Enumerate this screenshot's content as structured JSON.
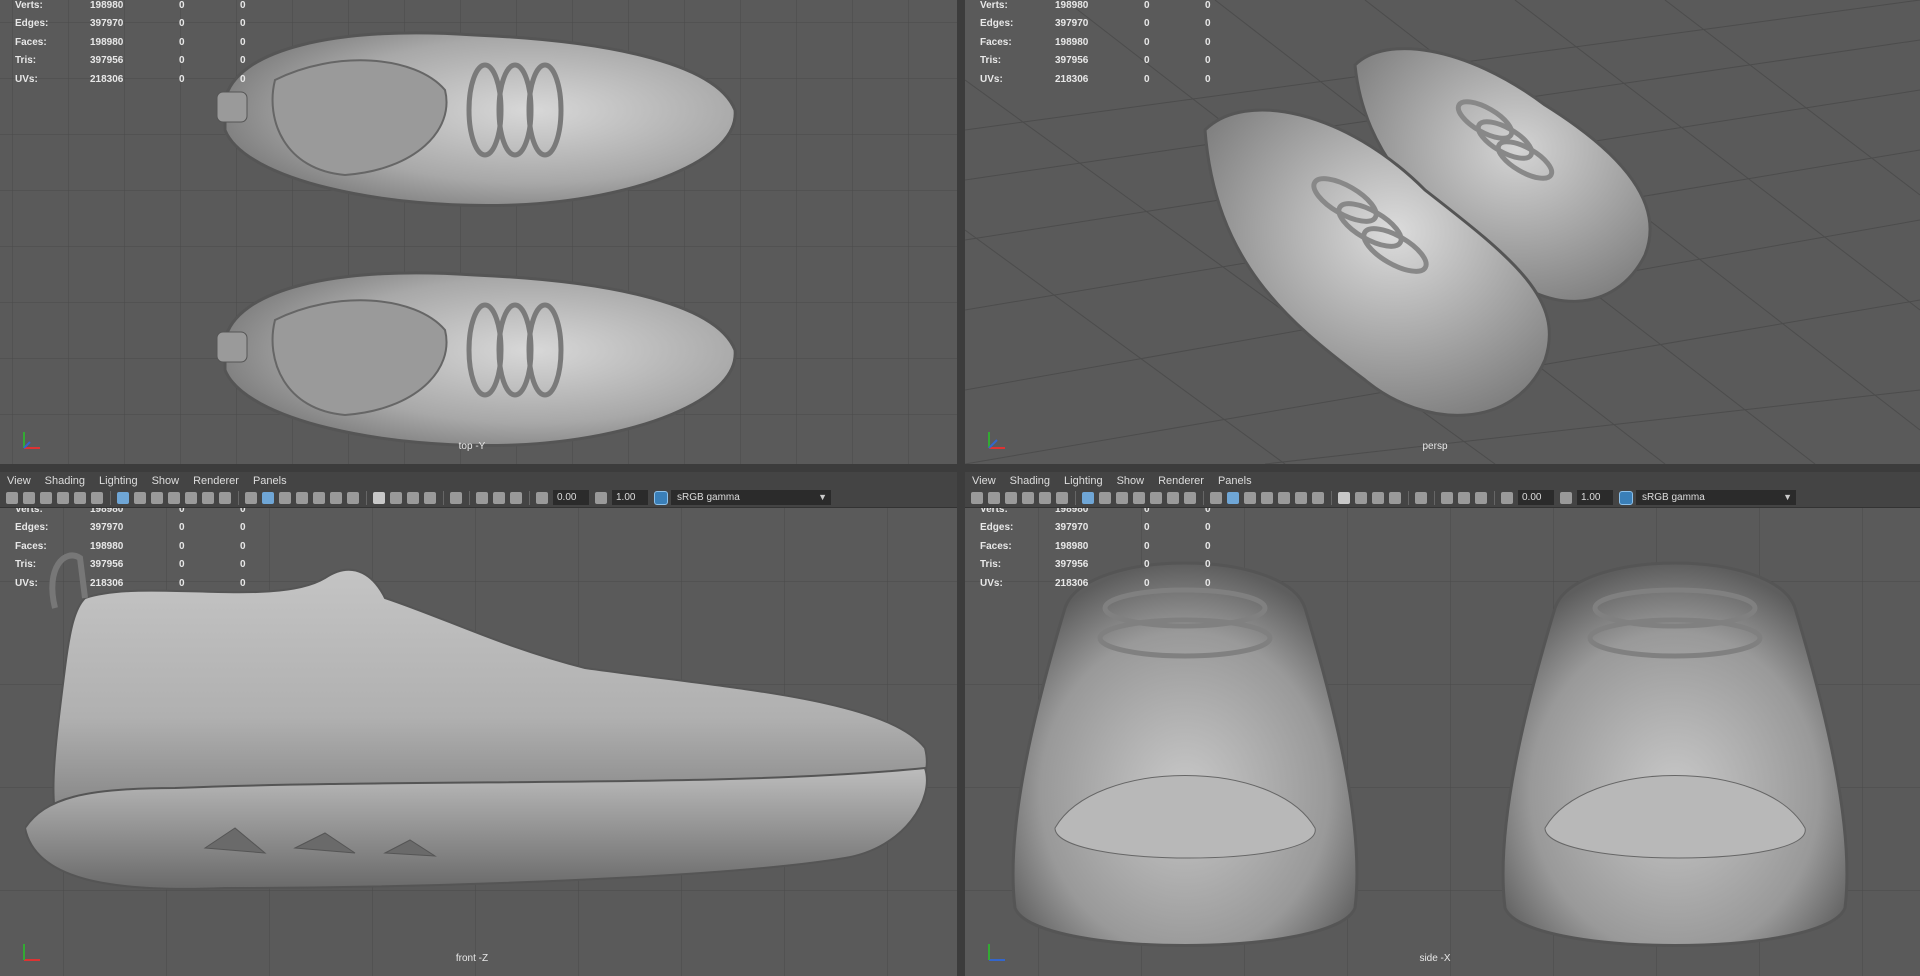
{
  "stats_labels": [
    "Verts:",
    "Edges:",
    "Faces:",
    "Tris:",
    "UVs:"
  ],
  "stats": [
    {
      "label": "Verts:",
      "value": "198980",
      "sel": "0",
      "extra": "0"
    },
    {
      "label": "Edges:",
      "value": "397970",
      "sel": "0",
      "extra": "0"
    },
    {
      "label": "Faces:",
      "value": "198980",
      "sel": "0",
      "extra": "0"
    },
    {
      "label": "Tris:",
      "value": "397956",
      "sel": "0",
      "extra": "0"
    },
    {
      "label": "UVs:",
      "value": "218306",
      "sel": "0",
      "extra": "0"
    }
  ],
  "viewports": {
    "top": {
      "camera": "top -Y"
    },
    "persp": {
      "camera": "persp"
    },
    "front": {
      "camera": "front -Z"
    },
    "side": {
      "camera": "side -X"
    }
  },
  "menu": [
    "View",
    "Shading",
    "Lighting",
    "Show",
    "Renderer",
    "Panels"
  ],
  "toolbar": {
    "exposure": "0.00",
    "gamma": "1.00",
    "color_space": "sRGB gamma",
    "dropdown_icon": "chevron-down-icon"
  },
  "colors": {
    "viewport_bg": "#5a5a5a",
    "grid": "#4a4a4a",
    "mesh": "#b8b8b8",
    "accent": "#3a7fb8"
  }
}
